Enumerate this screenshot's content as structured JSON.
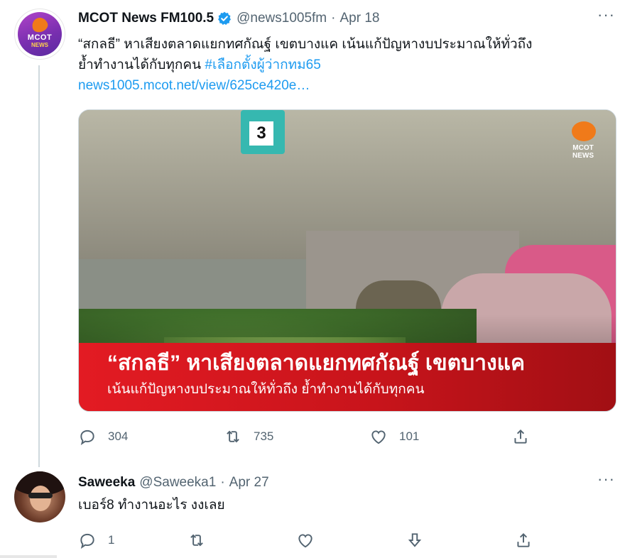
{
  "tweet": {
    "author_name": "MCOT News FM100.5",
    "handle": "@news1005fm",
    "separator": "·",
    "date": "Apr 18",
    "more": "···",
    "avatar_mcot": "MCOT",
    "avatar_news": "NEWS",
    "text_line1": "“สกลธี” หาเสียงตลาดแยกทศกัณฐ์ เขตบางแค เน้นแก้ปัญหางบประมาณให้ทั่วถึง",
    "text_line2_plain": "ย้ำทำงานได้กับทุกคน ",
    "hashtag": "#เลือกตั้งผู้ว่ากทม65",
    "link": "news1005.mcot.net/view/625ce420e…",
    "media": {
      "sign_number": "3",
      "logo_text_1": "MCOT",
      "logo_text_2": "NEWS",
      "banner_title": "“สกลธี” หาเสียงตลาดแยกทศกัณฐ์ เขตบางแค",
      "banner_sub": "เน้นแก้ปัญหางบประมาณให้ทั่วถึง  ย้ำทำงานได้กับทุกคน"
    },
    "actions": {
      "reply_count": "304",
      "retweet_count": "735",
      "like_count": "101"
    }
  },
  "reply": {
    "author_name": "Saweeka",
    "handle": "@Saweeka1",
    "separator": "·",
    "date": "Apr 27",
    "more": "···",
    "text": "เบอร์8 ทำงานอะไร งงเลย",
    "actions": {
      "reply_count": "1"
    }
  },
  "colors": {
    "accent": "#1d9bf0",
    "secondary_text": "#536471",
    "banner_red": "#e31b23"
  },
  "icons": [
    "verified-badge-icon",
    "more-icon",
    "reply-icon",
    "retweet-icon",
    "like-icon",
    "share-icon",
    "downvote-icon"
  ]
}
